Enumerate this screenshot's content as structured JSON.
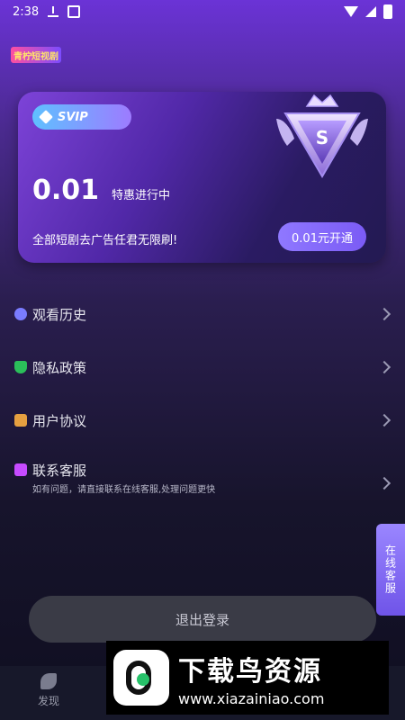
{
  "status_bar": {
    "time": "2:38"
  },
  "app": {
    "logo_text": "青柠短视剧"
  },
  "vip_card": {
    "badge": "SVIP",
    "price": "0.01",
    "promo": "特惠进行中",
    "description": "全部短剧去广告任君无限刷!",
    "open_button": "0.01元开通",
    "emblem_letter": "S"
  },
  "menu": {
    "items": [
      {
        "label": "观看历史",
        "icon": "clock-icon",
        "color": "#7a7cff"
      },
      {
        "label": "隐私政策",
        "icon": "shield-icon",
        "color": "#2bbf5a"
      },
      {
        "label": "用户协议",
        "icon": "document-icon",
        "color": "#e6a040"
      },
      {
        "label": "联系客服",
        "icon": "mail-icon",
        "color": "#c64bff",
        "subtitle": "如有问题，请直接联系在线客服,处理问题更快"
      }
    ]
  },
  "online_service": {
    "label": "在线客服"
  },
  "logout": {
    "label": "退出登录"
  },
  "tabbar": {
    "discover": "发现"
  },
  "watermark": {
    "title": "下载鸟资源",
    "url": "www.xiazainiao.com"
  }
}
